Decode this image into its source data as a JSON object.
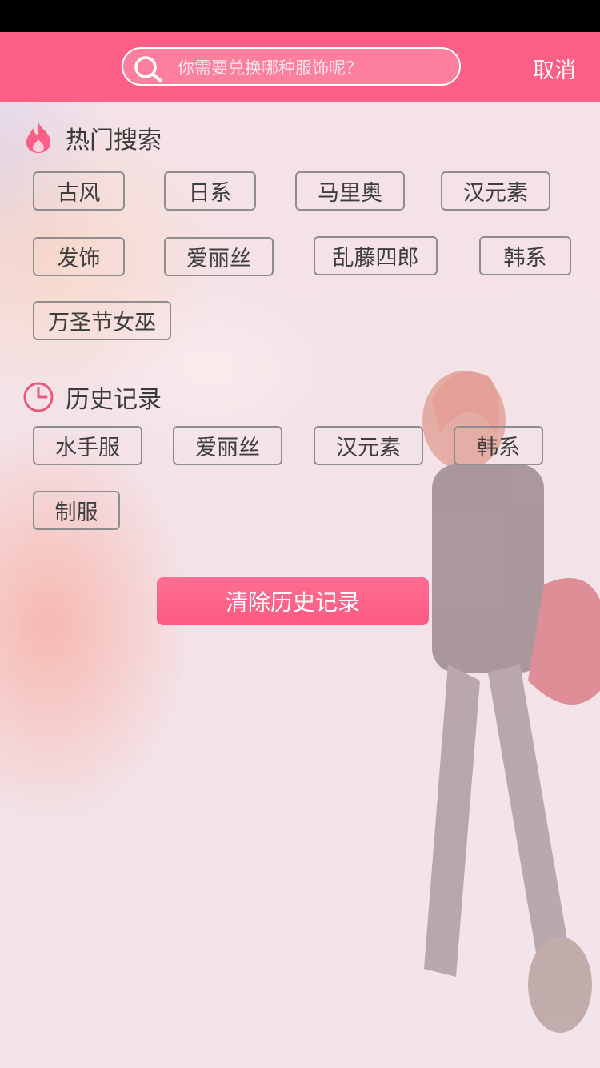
{
  "search": {
    "placeholder": "你需要兑换哪种服饰呢？",
    "cancel_label": "取消"
  },
  "hot": {
    "title": "热门搜索",
    "tags": [
      "古风",
      "日系",
      "马里奥",
      "汉元素",
      "发饰",
      "爱丽丝",
      "乱藤四郎",
      "韩系",
      "万圣节女巫"
    ]
  },
  "history": {
    "title": "历史记录",
    "tags": [
      "水手服",
      "爱丽丝",
      "汉元素",
      "韩系",
      "制服"
    ]
  },
  "clear_button_label": "清除历史记录",
  "colors": {
    "brand": "#fe5f86",
    "tag_border": "#8d8d8d",
    "text": "#3a3a3a"
  },
  "icons": {
    "search": "search-icon",
    "hot": "flame-icon",
    "history": "clock-icon"
  }
}
